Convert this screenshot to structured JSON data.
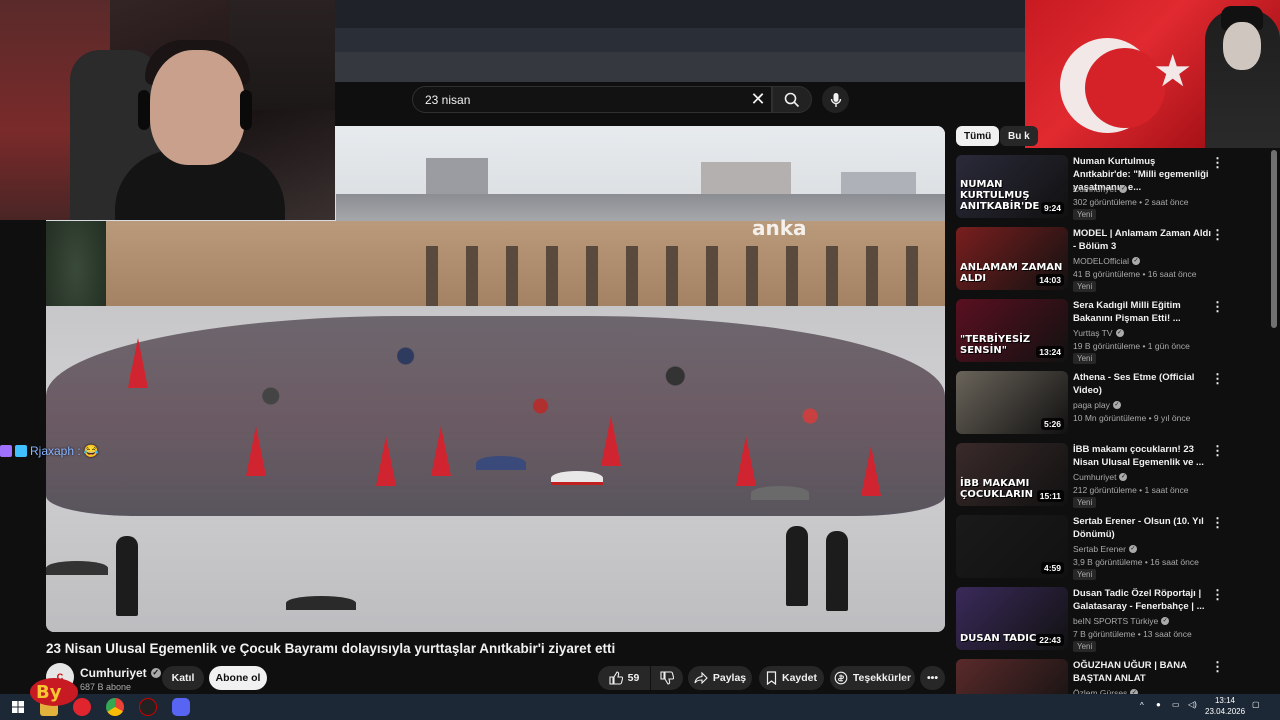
{
  "search": {
    "query": "23 nisan"
  },
  "chips": [
    "Tümü",
    "Bu k"
  ],
  "video": {
    "watermark": "anka",
    "title": "23 Nisan Ulusal Egemenlik ve Çocuk Bayramı dolayısıyla yurttaşlar Anıtkabir'i ziyaret etti",
    "channel": "Cumhuriyet",
    "subscribers": "687 B abone",
    "join_label": "Katıl",
    "subscribe_label": "Abone ol",
    "likes": "59",
    "share_label": "Paylaş",
    "save_label": "Kaydet",
    "thanks_label": "Teşekkürler"
  },
  "chat": {
    "user": "Rjaxaph :"
  },
  "sidebar": [
    {
      "title": "Numan Kurtulmuş Anıtkabir'de: \"Milli egemenliği yaşatmanın e...",
      "channel": "Cumhuriyet",
      "verified": true,
      "meta": "302 görüntüleme • 2 saat önce",
      "badge": "Yeni",
      "duration": "9:24",
      "thumb_text": "NUMAN KURTULMUŞ ANITKABİR'DE",
      "thumb_color": "#2a2a3a"
    },
    {
      "title": "MODEL | Anlamam Zaman Aldı - Bölüm 3",
      "channel": "MODELOfficial",
      "verified": true,
      "meta": "41 B görüntüleme • 16 saat önce",
      "badge": "Yeni",
      "duration": "14:03",
      "thumb_text": "ANLAMAM ZAMAN ALDI",
      "thumb_color": "#7a1e1e"
    },
    {
      "title": "Sera Kadıgil Milli Eğitim Bakanını Pişman Etti! ...",
      "channel": "Yurttaş TV",
      "verified": true,
      "meta": "19 B görüntüleme • 1 gün önce",
      "badge": "Yeni",
      "duration": "13:24",
      "thumb_text": "\"TERBİYESİZ SENSİN\"",
      "thumb_color": "#5a1020"
    },
    {
      "title": "Athena - Ses Etme (Official Video)",
      "channel": "paga play",
      "verified": true,
      "meta": "10 Mn görüntüleme • 9 yıl önce",
      "badge": "",
      "duration": "5:26",
      "thumb_text": "",
      "thumb_color": "#6a645a"
    },
    {
      "title": "İBB makamı çocukların! 23 Nisan Ulusal Egemenlik ve ...",
      "channel": "Cumhuriyet",
      "verified": true,
      "meta": "212 görüntüleme • 1 saat önce",
      "badge": "Yeni",
      "duration": "15:11",
      "thumb_text": "İBB MAKAMI ÇOCUKLARIN",
      "thumb_color": "#3a2a2a"
    },
    {
      "title": "Sertab Erener - Olsun (10. Yıl Dönümü)",
      "channel": "Sertab Erener",
      "verified": true,
      "meta": "3,9 B görüntüleme • 16 saat önce",
      "badge": "Yeni",
      "duration": "4:59",
      "thumb_text": "",
      "thumb_color": "#1a1a1a"
    },
    {
      "title": "Dusan Tadic Özel Röportajı | Galatasaray - Fenerbahçe | ...",
      "channel": "beIN SPORTS Türkiye",
      "verified": true,
      "meta": "7 B görüntüleme • 13 saat önce",
      "badge": "Yeni",
      "duration": "22:43",
      "thumb_text": "DUSAN TADIC",
      "thumb_color": "#3a2a5a"
    },
    {
      "title": "OĞUZHAN UĞUR | BANA BAŞTAN ANLAT",
      "channel": "Özlem Gürses",
      "verified": true,
      "meta": "",
      "badge": "",
      "duration": "",
      "thumb_text": "",
      "thumb_color": "#5a2a2a"
    }
  ],
  "taskbar": {
    "time": "13:14",
    "date": "23.04.2026"
  },
  "colors": {
    "background": "#0f0f0f",
    "text": "#f1f1f1",
    "secondary": "#aaaaaa",
    "flag_red": "#e02a30",
    "taskbar": "#1c2836"
  }
}
